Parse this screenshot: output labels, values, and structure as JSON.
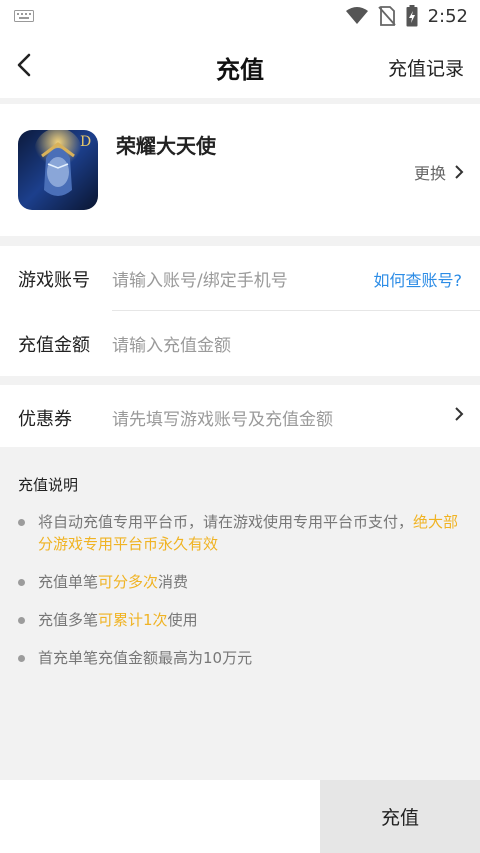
{
  "status_bar": {
    "time": "2:52",
    "icons": [
      "keyboard-icon",
      "wifi-icon",
      "no-sim-icon",
      "battery-charging-icon"
    ]
  },
  "header": {
    "title": "充值",
    "right_link": "充值记录"
  },
  "game": {
    "name": "荣耀大天使",
    "change_label": "更换"
  },
  "form": {
    "account_label": "游戏账号",
    "account_placeholder": "请输入账号/绑定手机号",
    "account_help": "如何查账号?",
    "amount_label": "充值金额",
    "amount_placeholder": "请输入充值金额",
    "coupon_label": "优惠券",
    "coupon_placeholder": "请先填写游戏账号及充值金额"
  },
  "notes": {
    "title": "充值说明",
    "n1_part1": "将自动充值专用平台币，请在游戏使用专用平台币支付，",
    "n1_highlight": "绝大部分游戏专用平台币永久有效",
    "n2_part1": "充值单笔",
    "n2_highlight": "可分多次",
    "n2_part2": "消费",
    "n3_part1": "充值多笔",
    "n3_highlight": "可累计1次",
    "n3_part2": "使用",
    "n4": "首充单笔充值金额最高为10万元"
  },
  "footer": {
    "pay_button": "充值"
  },
  "colors": {
    "accent_link": "#2c8ce6",
    "highlight": "#f0b323",
    "button_bg": "#e6e6e6"
  }
}
